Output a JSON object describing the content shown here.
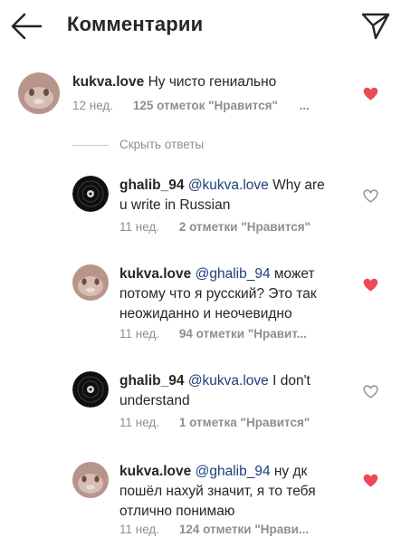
{
  "header": {
    "title": "Комментарии"
  },
  "colors": {
    "heart_active": "#ed4956",
    "muted": "#8e8e8e",
    "mention": "#1c3f7a"
  },
  "main_comment": {
    "username": "kukva.love",
    "text": "Ну чисто гениально",
    "time": "12 нед.",
    "likes": "125 отметок \"Нравится\"",
    "more": "...",
    "liked": true
  },
  "hide_replies": {
    "label": "Скрыть ответы"
  },
  "replies": [
    {
      "username": "ghalib_94",
      "mention": "@kukva.love",
      "text_line1": "Why are",
      "text_line2": "u write in Russian",
      "text_line3": "",
      "time": "11 нед.",
      "likes": "2 отметки \"Нравится\"",
      "liked": false
    },
    {
      "username": "kukva.love",
      "mention": "@ghalib_94",
      "text_line1": "может",
      "text_line2": "потому что я русский? Это так",
      "text_line3": "неожиданно и неочевидно",
      "time": "11 нед.",
      "likes": "94 отметки \"Нравит...",
      "liked": true
    },
    {
      "username": "ghalib_94",
      "mention": "@kukva.love",
      "text_line1": "I don't",
      "text_line2": "understand",
      "text_line3": "",
      "time": "11 нед.",
      "likes": "1 отметка \"Нравится\"",
      "liked": false
    },
    {
      "username": "kukva.love",
      "mention": "@ghalib_94",
      "text_line1": "ну дк",
      "text_line2": "пошёл нахуй значит, я то тебя",
      "text_line3": "отлично понимаю",
      "time": "11 нед.",
      "likes": "124 отметки \"Нрави...",
      "liked": true
    }
  ]
}
